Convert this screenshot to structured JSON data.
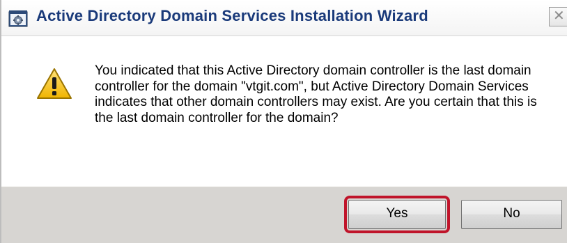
{
  "window": {
    "title": "Active Directory Domain Services Installation Wizard",
    "close_glyph": "✕"
  },
  "icons": {
    "app": "server-wizard-icon",
    "message": "warning-icon"
  },
  "message": {
    "text": "You indicated that this Active Directory domain controller is the last domain controller for the domain \"vtgit.com\", but Active Directory Domain Services indicates that other domain controllers may exist. Are you certain that this is the last domain controller for the domain?"
  },
  "buttons": {
    "yes_label": "Yes",
    "no_label": "No"
  },
  "colors": {
    "title_text": "#1a3a7a",
    "footer_bg": "#d7d5d2",
    "highlight": "#c0142a",
    "warning_fill": "#f5c518"
  }
}
